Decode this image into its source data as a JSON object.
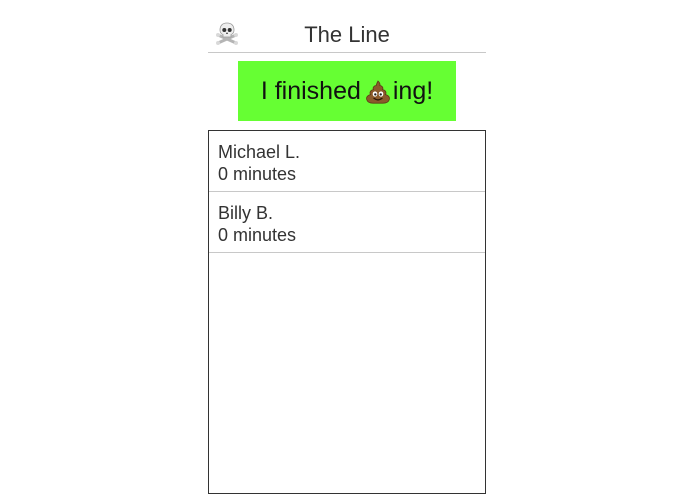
{
  "header": {
    "icon": "skull-and-crossbones-icon",
    "title": "The Line"
  },
  "action": {
    "label_before": "I finished ",
    "icon": "pile-of-poo-icon",
    "label_after": "ing!",
    "background_color": "#66ff33"
  },
  "queue": {
    "items": [
      {
        "name": "Michael L.",
        "wait": "0 minutes"
      },
      {
        "name": "Billy B.",
        "wait": "0 minutes"
      }
    ]
  }
}
